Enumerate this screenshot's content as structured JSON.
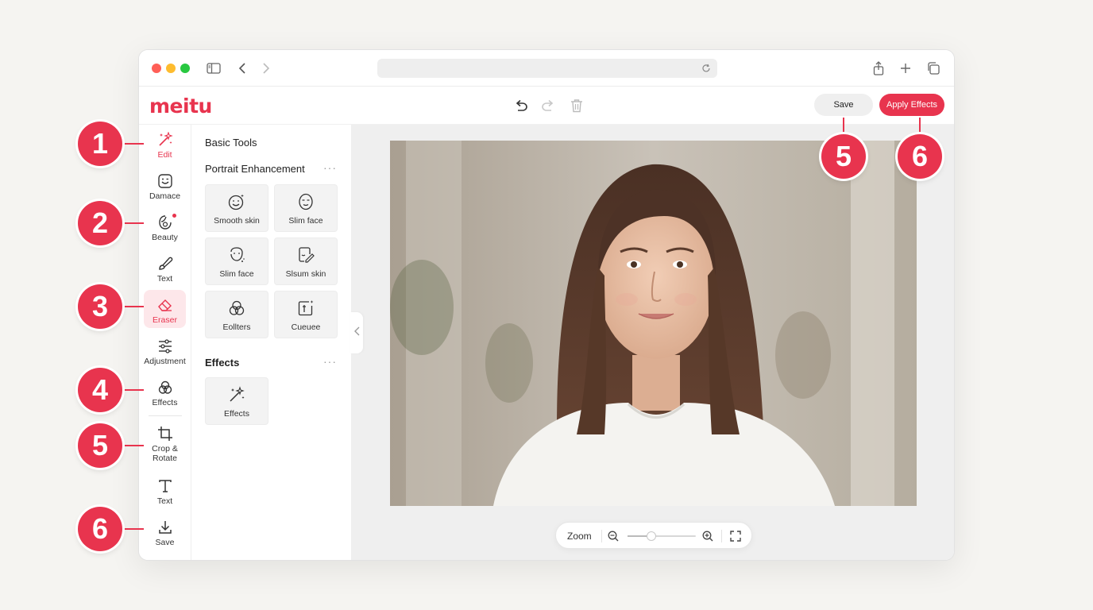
{
  "browser": {
    "icons": [
      "sidebar-icon",
      "back-icon",
      "forward-icon",
      "reload-icon",
      "share-icon",
      "new-tab-icon",
      "tabs-icon"
    ]
  },
  "app": {
    "logo": "meitu",
    "toolbar": {
      "undo_icon": "undo-icon",
      "redo_icon": "redo-icon",
      "delete_icon": "trash-icon",
      "save_label": "Save",
      "apply_label": "Apply Effects"
    }
  },
  "sidebar": {
    "items": [
      {
        "label": "Edit",
        "icon": "magic-wand-icon",
        "state": "highlighted"
      },
      {
        "label": "Damace",
        "icon": "face-frame-icon"
      },
      {
        "label": "Beauty",
        "icon": "beauty-face-icon",
        "badge": true
      },
      {
        "label": "Text",
        "icon": "brush-icon"
      },
      {
        "label": "Eraser",
        "icon": "eraser-icon",
        "state": "active"
      },
      {
        "label": "Adjustment",
        "icon": "sliders-icon"
      },
      {
        "label": "Effects",
        "icon": "circles-icon"
      },
      {
        "label": "Crop & Rotate",
        "icon": "crop-icon"
      },
      {
        "label": "Text",
        "icon": "text-icon"
      },
      {
        "label": "Save",
        "icon": "download-icon"
      }
    ]
  },
  "panel": {
    "title": "Basic Tools",
    "sections": [
      {
        "title": "Portrait Enhancement",
        "more": "···",
        "tools": [
          {
            "label": "Smooth skin",
            "icon": "smooth-skin-icon"
          },
          {
            "label": "Slim face",
            "icon": "slim-face-icon"
          },
          {
            "label": "Slim face",
            "icon": "face-dots-icon"
          },
          {
            "label": "Slsum skin",
            "icon": "face-edit-icon"
          },
          {
            "label": "Eollters",
            "icon": "filters-icon"
          },
          {
            "label": "Cueuee",
            "icon": "adjust-frame-icon"
          }
        ]
      },
      {
        "title": "Effects",
        "more": "···",
        "tools": [
          {
            "label": "Effects",
            "icon": "magic-wand-icon"
          }
        ]
      }
    ]
  },
  "canvas": {
    "zoom_label": "Zoom",
    "zoom_level": 0.35,
    "icons": [
      "zoom-out-icon",
      "zoom-in-icon",
      "fit-screen-icon"
    ]
  },
  "callouts": [
    "1",
    "2",
    "3",
    "4",
    "5",
    "6",
    "5",
    "6"
  ],
  "colors": {
    "accent": "#e8344e",
    "background": "#f5f4f1",
    "canvas": "#efefef"
  }
}
